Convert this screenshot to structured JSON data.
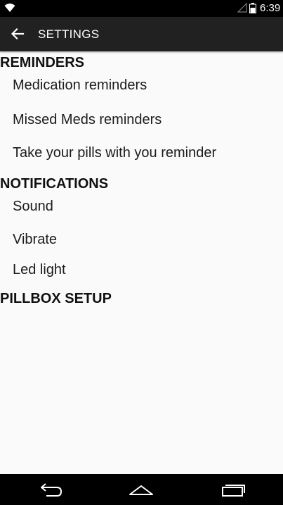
{
  "status_bar": {
    "time": "6:39",
    "icons": [
      "wifi-icon",
      "signal-icon",
      "battery-icon"
    ]
  },
  "app_bar": {
    "back_icon": "arrow-left-icon",
    "title": "SETTINGS"
  },
  "sections": [
    {
      "header": "REMINDERS",
      "items": [
        "Medication reminders",
        "Missed Meds reminders",
        "Take your pills with you reminder"
      ]
    },
    {
      "header": "NOTIFICATIONS",
      "items": [
        "Sound",
        "Vibrate",
        "Led light"
      ]
    },
    {
      "header": "PILLBOX SETUP",
      "items": []
    }
  ],
  "nav_bar": {
    "buttons": [
      "back-nav-icon",
      "home-nav-icon",
      "recents-nav-icon"
    ]
  }
}
